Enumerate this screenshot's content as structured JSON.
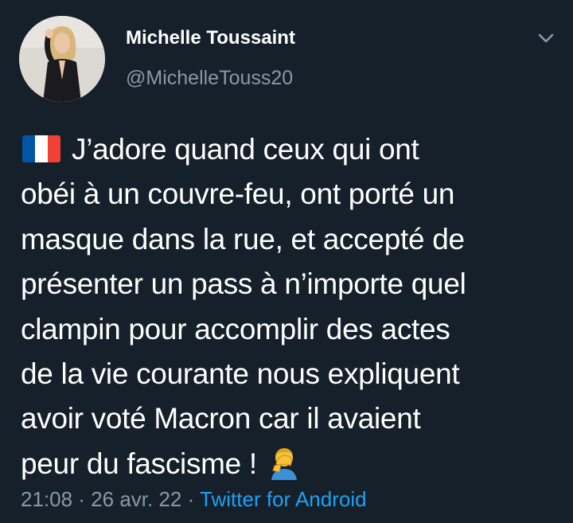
{
  "user": {
    "display_name": "Michelle Toussaint",
    "handle": "@MichelleTouss20"
  },
  "tweet": {
    "lines": [
      "J’adore quand ceux qui ont",
      "obéi à un couvre-feu, ont porté un",
      "masque dans la rue, et accepté de",
      "présenter un pass à n’importe quel",
      "clampin pour accomplir des actes",
      "de la vie courante nous expliquent",
      "avoir voté Macron car il avaient",
      "peur du fascisme !"
    ],
    "leading_emoji": "french-flag-icon",
    "trailing_emoji": "facepalm-icon"
  },
  "meta": {
    "time": "21:08",
    "separator": " · ",
    "date": "26 avr. 22",
    "source": "Twitter for Android"
  },
  "colors": {
    "background": "#15202b",
    "text": "#ffffff",
    "muted": "#8899a6",
    "link": "#1da1f2"
  }
}
